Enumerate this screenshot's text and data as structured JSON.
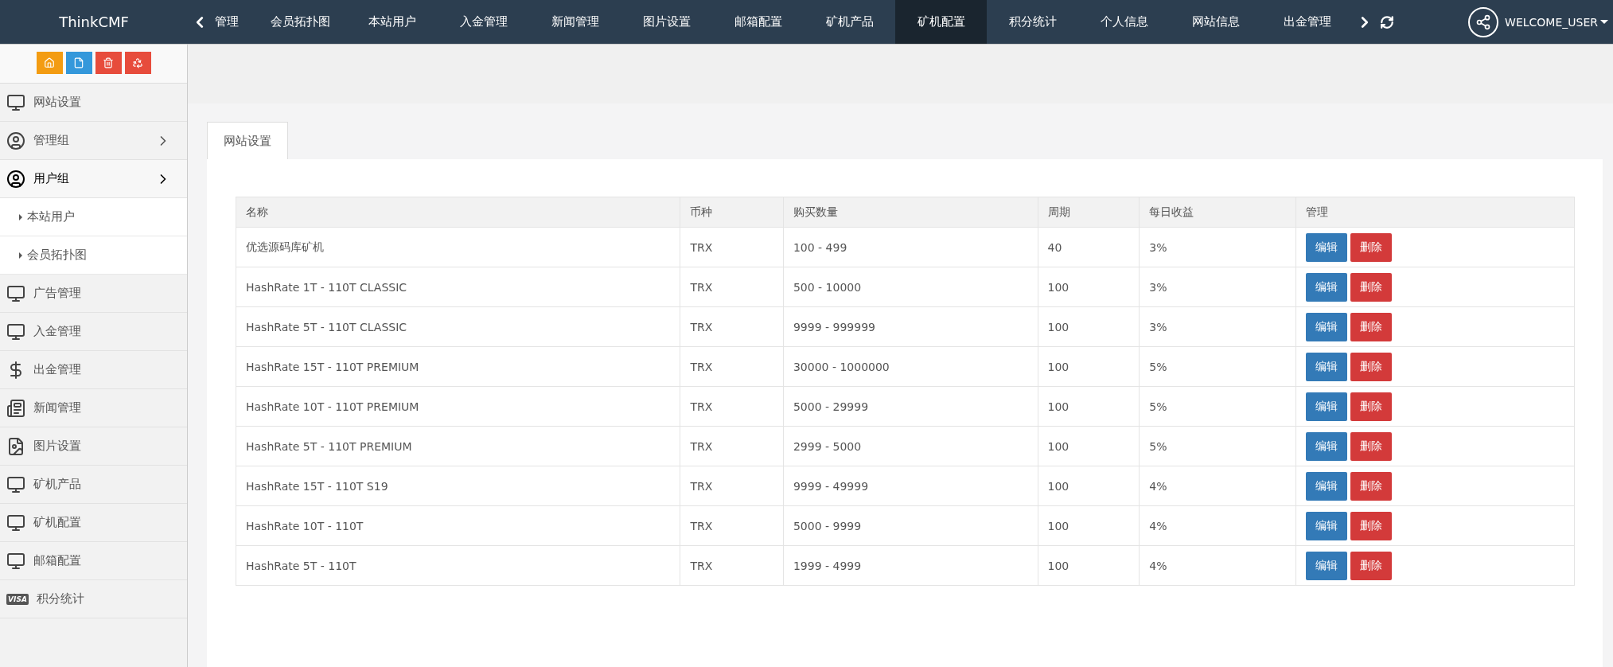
{
  "brand": "ThinkCMF",
  "nav": [
    {
      "label": "管理",
      "selected": false
    },
    {
      "label": "会员拓扑图",
      "selected": false
    },
    {
      "label": "本站用户",
      "selected": false
    },
    {
      "label": "入金管理",
      "selected": false
    },
    {
      "label": "新闻管理",
      "selected": false
    },
    {
      "label": "图片设置",
      "selected": false
    },
    {
      "label": "邮箱配置",
      "selected": false
    },
    {
      "label": "矿机产品",
      "selected": false
    },
    {
      "label": "矿机配置",
      "selected": true
    },
    {
      "label": "积分统计",
      "selected": false
    },
    {
      "label": "个人信息",
      "selected": false
    },
    {
      "label": "网站信息",
      "selected": false
    },
    {
      "label": "出金管理",
      "selected": false
    }
  ],
  "user": {
    "name": "WELCOME_USER"
  },
  "toolbar": [
    {
      "kind": "home",
      "color": "#f39c12"
    },
    {
      "kind": "file",
      "color": "#3498db"
    },
    {
      "kind": "trash",
      "color": "#e74c3c"
    },
    {
      "kind": "recycle",
      "color": "#e74c3c"
    }
  ],
  "sidebar": {
    "items": [
      {
        "label": "网站设置",
        "kind": "monitor"
      },
      {
        "label": "管理组",
        "kind": "person",
        "expanded": false
      },
      {
        "label": "用户组",
        "kind": "person",
        "expanded": true,
        "children": [
          {
            "label": "本站用户"
          },
          {
            "label": "会员拓扑图"
          }
        ]
      },
      {
        "label": "广告管理",
        "kind": "monitor"
      },
      {
        "label": "入金管理",
        "kind": "monitor"
      },
      {
        "label": "出金管理",
        "kind": "dollar"
      },
      {
        "label": "新闻管理",
        "kind": "newspaper"
      },
      {
        "label": "图片设置",
        "kind": "image"
      },
      {
        "label": "矿机产品",
        "kind": "monitor"
      },
      {
        "label": "矿机配置",
        "kind": "monitor"
      },
      {
        "label": "邮箱配置",
        "kind": "monitor"
      },
      {
        "label": "积分统计",
        "kind": "card",
        "card_text": "VISA"
      }
    ]
  },
  "tabs": [
    {
      "label": "网站设置",
      "selected": true
    }
  ],
  "table": {
    "columns": [
      "名称",
      "币种",
      "购买数量",
      "周期",
      "每日收益",
      "管理"
    ],
    "rows": [
      {
        "cells": [
          "优选源码库矿机",
          "TRX",
          "100 - 499",
          "40",
          "3%"
        ],
        "actions": [
          "编辑",
          "删除"
        ]
      },
      {
        "cells": [
          "HashRate 1T - 110T CLASSIC",
          "TRX",
          "500 - 10000",
          "100",
          "3%"
        ],
        "actions": [
          "编辑",
          "删除"
        ]
      },
      {
        "cells": [
          "HashRate 5T - 110T CLASSIC",
          "TRX",
          "9999 - 999999",
          "100",
          "3%"
        ],
        "actions": [
          "编辑",
          "删除"
        ]
      },
      {
        "cells": [
          "HashRate 15T - 110T PREMIUM",
          "TRX",
          "30000 - 1000000",
          "100",
          "5%"
        ],
        "actions": [
          "编辑",
          "删除"
        ]
      },
      {
        "cells": [
          "HashRate 10T - 110T PREMIUM",
          "TRX",
          "5000 - 29999",
          "100",
          "5%"
        ],
        "actions": [
          "编辑",
          "删除"
        ]
      },
      {
        "cells": [
          "HashRate 5T - 110T PREMIUM",
          "TRX",
          "2999 - 5000",
          "100",
          "5%"
        ],
        "actions": [
          "编辑",
          "删除"
        ]
      },
      {
        "cells": [
          "HashRate 15T - 110T S19",
          "TRX",
          "9999 - 49999",
          "100",
          "4%"
        ],
        "actions": [
          "编辑",
          "删除"
        ]
      },
      {
        "cells": [
          "HashRate 10T - 110T",
          "TRX",
          "5000 - 9999",
          "100",
          "4%"
        ],
        "actions": [
          "编辑",
          "删除"
        ]
      },
      {
        "cells": [
          "HashRate 5T - 110T",
          "TRX",
          "1999 - 4999",
          "100",
          "4%"
        ],
        "actions": [
          "编辑",
          "删除"
        ]
      }
    ]
  }
}
